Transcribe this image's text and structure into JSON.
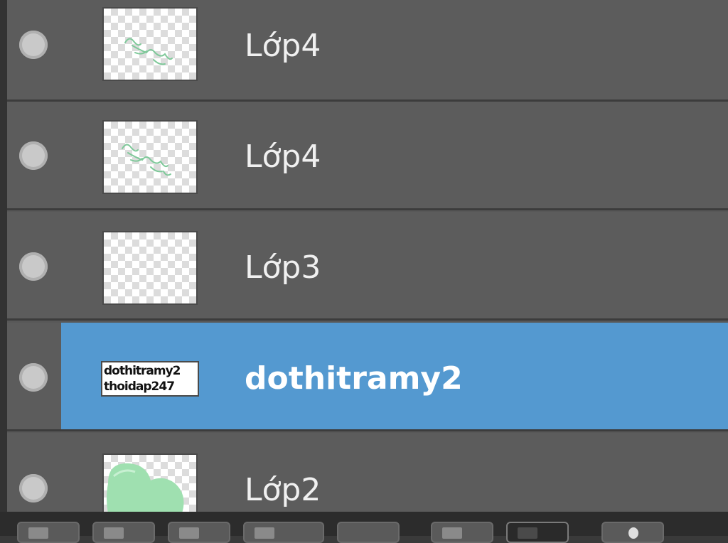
{
  "layers": [
    {
      "name": "Lớp4",
      "thumbnail": "sketch-scribble",
      "selected": false
    },
    {
      "name": "Lớp4",
      "thumbnail": "sketch-scribble",
      "selected": false
    },
    {
      "name": "Lớp3",
      "thumbnail": "empty-transparent",
      "selected": false
    },
    {
      "name": "dothitramy2",
      "thumbnail": "text-preview",
      "thumbnail_text": [
        "dothitramy2",
        "thoidap247"
      ],
      "selected": true
    },
    {
      "name": "Lớp2",
      "thumbnail": "green-shape",
      "selected": false
    }
  ],
  "colors": {
    "panel_bg": "#5c5c5c",
    "selected_bg": "#5499d0",
    "separator": "#3c3c3c",
    "visibility_dot": "#c9c9c9",
    "scribble_green": "#7fc99a"
  },
  "icons": {
    "visibility": "visibility-dot-icon",
    "bottom_bar_buttons": [
      "new-layer-icon",
      "duplicate-layer-icon",
      "merge-layer-icon",
      "group-layer-icon",
      "mask-icon",
      "adjust-icon",
      "folder-icon",
      "delete-layer-icon"
    ]
  }
}
